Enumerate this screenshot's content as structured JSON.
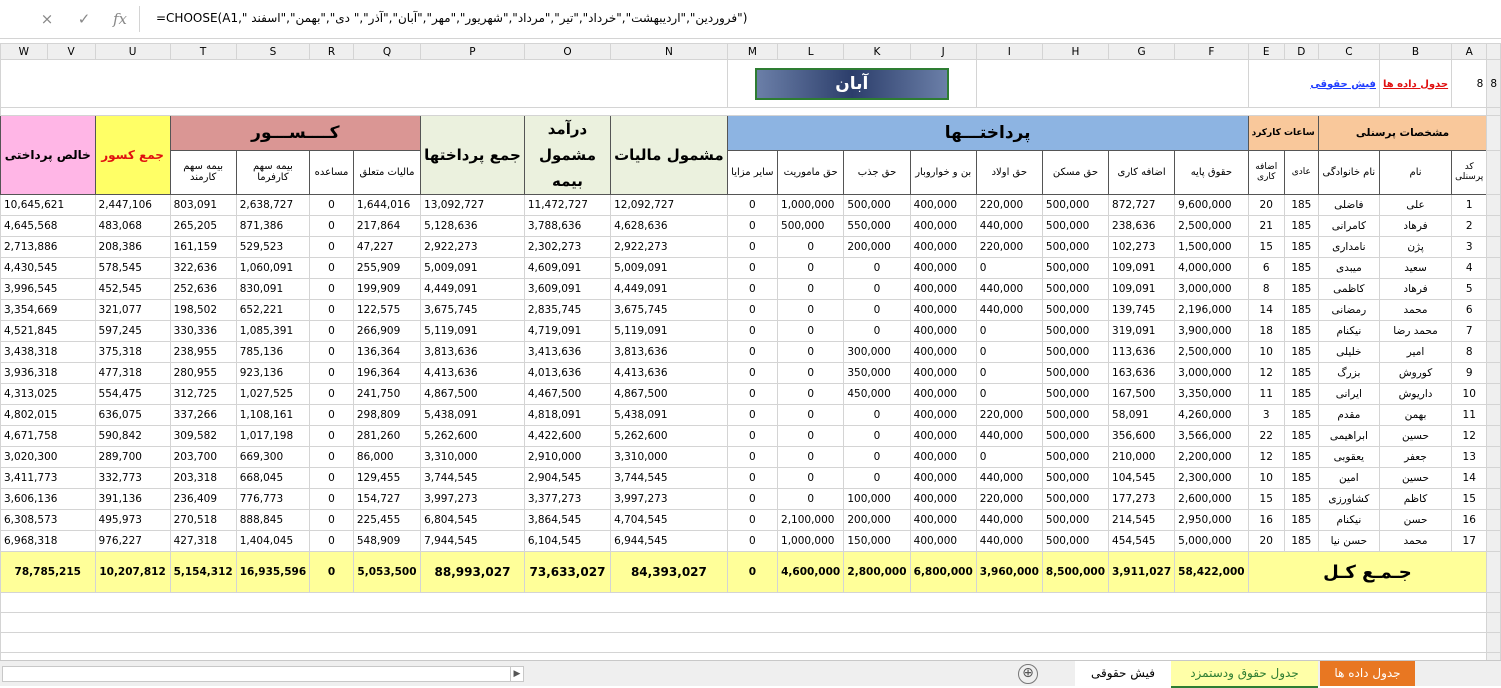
{
  "formula_bar": {
    "cancel_icon": "×",
    "enter_icon": "✓",
    "fx_label": "fx",
    "formula": "=CHOOSE(A1,\" فروردین\",\"اردیبهشت\",\"خرداد\",\"تیر\",\"مرداد\",\"شهریور\",\"مهر\",\"آبان\",\"آذر\",\" دی\",\"بهمن\",\"اسفند\")"
  },
  "columns": [
    "A",
    "B",
    "C",
    "D",
    "E",
    "F",
    "G",
    "H",
    "I",
    "J",
    "K",
    "L",
    "M",
    "N",
    "O",
    "P",
    "Q",
    "R",
    "S",
    "T",
    "U",
    "V",
    "W"
  ],
  "row8": {
    "row_num": "8",
    "value": "8",
    "link_data": "جدول داده ها",
    "link_slip": "فیش حقوقی",
    "month_title": "آبان"
  },
  "groups": {
    "personal": "مشخصات پرسنلی",
    "hours": "ساعات کارکرد",
    "payments": "پرداختـــها",
    "deductions": "کــــســـور",
    "total_deductions": "جمع کسور",
    "net_pay": "خالص پرداختی",
    "total_payments": "جمع پرداختها",
    "insurable_income": "درآمد مشمول بیمه",
    "taxable": "مشمول مالیات"
  },
  "subheaders": {
    "personnel_code": "کد پرسنلی",
    "first_name": "نام",
    "last_name": "نام خانوادگی",
    "normal_hours": "عادی",
    "overtime_hours": "اضافه کاری",
    "base_salary": "حقوق پایه",
    "overtime_pay": "اضافه کاری",
    "housing": "حق مسکن",
    "child": "حق اولاد",
    "food": "بن و خواروبار",
    "attraction": "حق جذب",
    "mission": "حق ماموریت",
    "other": "سایر مزایا",
    "tax": "مالیات متعلق",
    "aid": "مساعده",
    "ins_employer": "بیمه سهم کارفرما",
    "ins_employee": "بیمه سهم کارمند"
  },
  "rows": [
    {
      "n": "1",
      "first": "علی",
      "last": "فاضلی",
      "h": "185",
      "ot": "20",
      "base": "9,600,000",
      "otp": "872,727",
      "house": "500,000",
      "child": "220,000",
      "food": "400,000",
      "attr": "500,000",
      "miss": "1,000,000",
      "other": "0",
      "taxable": "12,092,727",
      "ins": "11,472,727",
      "tpay": "13,092,727",
      "tax": "1,644,016",
      "aid": "0",
      "insr": "2,638,727",
      "inse": "803,091",
      "tded": "2,447,106",
      "net": "10,645,621"
    },
    {
      "n": "2",
      "first": "فرهاد",
      "last": "کامرانی",
      "h": "185",
      "ot": "21",
      "base": "2,500,000",
      "otp": "238,636",
      "house": "500,000",
      "child": "440,000",
      "food": "400,000",
      "attr": "550,000",
      "miss": "500,000",
      "other": "0",
      "taxable": "4,628,636",
      "ins": "3,788,636",
      "tpay": "5,128,636",
      "tax": "217,864",
      "aid": "0",
      "insr": "871,386",
      "inse": "265,205",
      "tded": "483,068",
      "net": "4,645,568"
    },
    {
      "n": "3",
      "first": "پژن",
      "last": "نامداری",
      "h": "185",
      "ot": "15",
      "base": "1,500,000",
      "otp": "102,273",
      "house": "500,000",
      "child": "220,000",
      "food": "400,000",
      "attr": "200,000",
      "miss": "0",
      "other": "0",
      "taxable": "2,922,273",
      "ins": "2,302,273",
      "tpay": "2,922,273",
      "tax": "47,227",
      "aid": "0",
      "insr": "529,523",
      "inse": "161,159",
      "tded": "208,386",
      "net": "2,713,886"
    },
    {
      "n": "4",
      "first": "سعید",
      "last": "میبدی",
      "h": "185",
      "ot": "6",
      "base": "4,000,000",
      "otp": "109,091",
      "house": "500,000",
      "child": "0",
      "food": "400,000",
      "attr": "0",
      "miss": "0",
      "other": "0",
      "taxable": "5,009,091",
      "ins": "4,609,091",
      "tpay": "5,009,091",
      "tax": "255,909",
      "aid": "0",
      "insr": "1,060,091",
      "inse": "322,636",
      "tded": "578,545",
      "net": "4,430,545"
    },
    {
      "n": "5",
      "first": "فرهاد",
      "last": "کاظمی",
      "h": "185",
      "ot": "8",
      "base": "3,000,000",
      "otp": "109,091",
      "house": "500,000",
      "child": "440,000",
      "food": "400,000",
      "attr": "0",
      "miss": "0",
      "other": "0",
      "taxable": "4,449,091",
      "ins": "3,609,091",
      "tpay": "4,449,091",
      "tax": "199,909",
      "aid": "0",
      "insr": "830,091",
      "inse": "252,636",
      "tded": "452,545",
      "net": "3,996,545"
    },
    {
      "n": "6",
      "first": "محمد",
      "last": "رمضانی",
      "h": "185",
      "ot": "14",
      "base": "2,196,000",
      "otp": "139,745",
      "house": "500,000",
      "child": "440,000",
      "food": "400,000",
      "attr": "0",
      "miss": "0",
      "other": "0",
      "taxable": "3,675,745",
      "ins": "2,835,745",
      "tpay": "3,675,745",
      "tax": "122,575",
      "aid": "0",
      "insr": "652,221",
      "inse": "198,502",
      "tded": "321,077",
      "net": "3,354,669"
    },
    {
      "n": "7",
      "first": "محمد رضا",
      "last": "نیکنام",
      "h": "185",
      "ot": "18",
      "base": "3,900,000",
      "otp": "319,091",
      "house": "500,000",
      "child": "0",
      "food": "400,000",
      "attr": "0",
      "miss": "0",
      "other": "0",
      "taxable": "5,119,091",
      "ins": "4,719,091",
      "tpay": "5,119,091",
      "tax": "266,909",
      "aid": "0",
      "insr": "1,085,391",
      "inse": "330,336",
      "tded": "597,245",
      "net": "4,521,845"
    },
    {
      "n": "8",
      "first": "امیر",
      "last": "خلیلی",
      "h": "185",
      "ot": "10",
      "base": "2,500,000",
      "otp": "113,636",
      "house": "500,000",
      "child": "0",
      "food": "400,000",
      "attr": "300,000",
      "miss": "0",
      "other": "0",
      "taxable": "3,813,636",
      "ins": "3,413,636",
      "tpay": "3,813,636",
      "tax": "136,364",
      "aid": "0",
      "insr": "785,136",
      "inse": "238,955",
      "tded": "375,318",
      "net": "3,438,318"
    },
    {
      "n": "9",
      "first": "کوروش",
      "last": "بزرگ",
      "h": "185",
      "ot": "12",
      "base": "3,000,000",
      "otp": "163,636",
      "house": "500,000",
      "child": "0",
      "food": "400,000",
      "attr": "350,000",
      "miss": "0",
      "other": "0",
      "taxable": "4,413,636",
      "ins": "4,013,636",
      "tpay": "4,413,636",
      "tax": "196,364",
      "aid": "0",
      "insr": "923,136",
      "inse": "280,955",
      "tded": "477,318",
      "net": "3,936,318"
    },
    {
      "n": "10",
      "first": "داریوش",
      "last": "ایرانی",
      "h": "185",
      "ot": "11",
      "base": "3,350,000",
      "otp": "167,500",
      "house": "500,000",
      "child": "0",
      "food": "400,000",
      "attr": "450,000",
      "miss": "0",
      "other": "0",
      "taxable": "4,867,500",
      "ins": "4,467,500",
      "tpay": "4,867,500",
      "tax": "241,750",
      "aid": "0",
      "insr": "1,027,525",
      "inse": "312,725",
      "tded": "554,475",
      "net": "4,313,025"
    },
    {
      "n": "11",
      "first": "بهمن",
      "last": "مقدم",
      "h": "185",
      "ot": "3",
      "base": "4,260,000",
      "otp": "58,091",
      "house": "500,000",
      "child": "220,000",
      "food": "400,000",
      "attr": "0",
      "miss": "0",
      "other": "0",
      "taxable": "5,438,091",
      "ins": "4,818,091",
      "tpay": "5,438,091",
      "tax": "298,809",
      "aid": "0",
      "insr": "1,108,161",
      "inse": "337,266",
      "tded": "636,075",
      "net": "4,802,015"
    },
    {
      "n": "12",
      "first": "حسین",
      "last": "ابراهیمی",
      "h": "185",
      "ot": "22",
      "base": "3,566,000",
      "otp": "356,600",
      "house": "500,000",
      "child": "440,000",
      "food": "400,000",
      "attr": "0",
      "miss": "0",
      "other": "0",
      "taxable": "5,262,600",
      "ins": "4,422,600",
      "tpay": "5,262,600",
      "tax": "281,260",
      "aid": "0",
      "insr": "1,017,198",
      "inse": "309,582",
      "tded": "590,842",
      "net": "4,671,758"
    },
    {
      "n": "13",
      "first": "جعفر",
      "last": "یعقوبی",
      "h": "185",
      "ot": "12",
      "base": "2,200,000",
      "otp": "210,000",
      "house": "500,000",
      "child": "0",
      "food": "400,000",
      "attr": "0",
      "miss": "0",
      "other": "0",
      "taxable": "3,310,000",
      "ins": "2,910,000",
      "tpay": "3,310,000",
      "tax": "86,000",
      "aid": "0",
      "insr": "669,300",
      "inse": "203,700",
      "tded": "289,700",
      "net": "3,020,300"
    },
    {
      "n": "14",
      "first": "حسین",
      "last": "امین",
      "h": "185",
      "ot": "10",
      "base": "2,300,000",
      "otp": "104,545",
      "house": "500,000",
      "child": "440,000",
      "food": "400,000",
      "attr": "0",
      "miss": "0",
      "other": "0",
      "taxable": "3,744,545",
      "ins": "2,904,545",
      "tpay": "3,744,545",
      "tax": "129,455",
      "aid": "0",
      "insr": "668,045",
      "inse": "203,318",
      "tded": "332,773",
      "net": "3,411,773"
    },
    {
      "n": "15",
      "first": "کاظم",
      "last": "کشاورزی",
      "h": "185",
      "ot": "15",
      "base": "2,600,000",
      "otp": "177,273",
      "house": "500,000",
      "child": "220,000",
      "food": "400,000",
      "attr": "100,000",
      "miss": "0",
      "other": "0",
      "taxable": "3,997,273",
      "ins": "3,377,273",
      "tpay": "3,997,273",
      "tax": "154,727",
      "aid": "0",
      "insr": "776,773",
      "inse": "236,409",
      "tded": "391,136",
      "net": "3,606,136"
    },
    {
      "n": "16",
      "first": "حسن",
      "last": "نیکنام",
      "h": "185",
      "ot": "16",
      "base": "2,950,000",
      "otp": "214,545",
      "house": "500,000",
      "child": "440,000",
      "food": "400,000",
      "attr": "200,000",
      "miss": "2,100,000",
      "other": "0",
      "taxable": "4,704,545",
      "ins": "3,864,545",
      "tpay": "6,804,545",
      "tax": "225,455",
      "aid": "0",
      "insr": "888,845",
      "inse": "270,518",
      "tded": "495,973",
      "net": "6,308,573"
    },
    {
      "n": "17",
      "first": "محمد",
      "last": "حسن نیا",
      "h": "185",
      "ot": "20",
      "base": "5,000,000",
      "otp": "454,545",
      "house": "500,000",
      "child": "440,000",
      "food": "400,000",
      "attr": "150,000",
      "miss": "1,000,000",
      "other": "0",
      "taxable": "6,944,545",
      "ins": "6,104,545",
      "tpay": "7,944,545",
      "tax": "548,909",
      "aid": "0",
      "insr": "1,404,045",
      "inse": "427,318",
      "tded": "976,227",
      "net": "6,968,318"
    }
  ],
  "totals": {
    "label": "جـمـع کـل",
    "base": "58,422,000",
    "otp": "3,911,027",
    "house": "8,500,000",
    "child": "3,960,000",
    "food": "6,800,000",
    "attr": "2,800,000",
    "miss": "4,600,000",
    "other": "0",
    "taxable": "84,393,027",
    "ins": "73,633,027",
    "tpay": "88,993,027",
    "tax": "5,053,500",
    "aid": "0",
    "insr": "16,935,596",
    "inse": "5,154,312",
    "tded": "10,207,812",
    "net": "78,785,215"
  },
  "tabs": {
    "add_icon": "⊕",
    "scroll_arrow": "▶",
    "items": [
      {
        "label": "جدول داده ها",
        "bg": "#e87722",
        "color": "#ffffff"
      },
      {
        "label": "جدول حقوق ودستمزد",
        "bg": "#ffffa8",
        "color": "#2e7d32"
      },
      {
        "label": "فیش حقوقی",
        "bg": "#ffffff",
        "color": "#000000"
      }
    ]
  },
  "colors": {
    "personal_header": "#f9c89b",
    "payments_header": "#8db4e2",
    "deductions_header": "#da9694",
    "total_deductions_header": "#ffff66",
    "net_pay_header": "#ffb6e6",
    "calc_header": "#ebf1de",
    "total_row": "#ffff99",
    "red_text": "#e01010",
    "link_red": "#e01010",
    "link_blue": "#1f3cff"
  }
}
